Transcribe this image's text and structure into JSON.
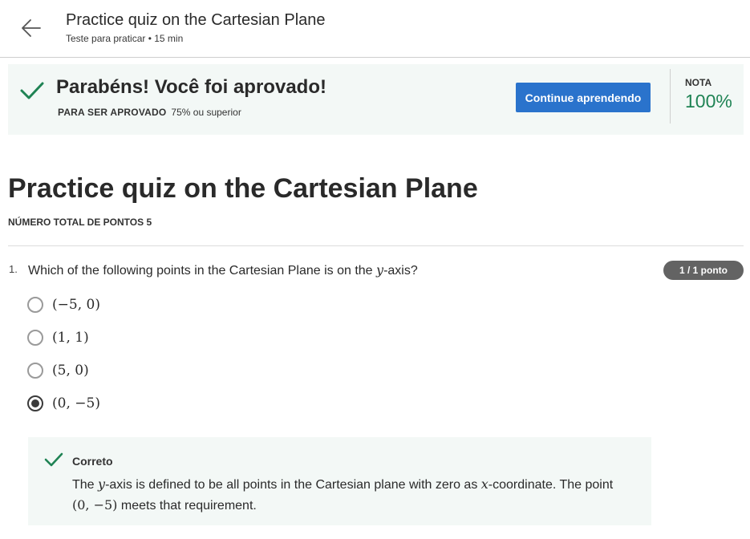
{
  "header": {
    "title": "Practice quiz on the Cartesian Plane",
    "subtitle": "Teste para praticar • 15 min"
  },
  "banner": {
    "title": "Parabéns! Você foi aprovado!",
    "pass_label": "PARA SER APROVADO",
    "pass_value": "75% ou superior",
    "continue_label": "Continue aprendendo",
    "grade_label": "NOTA",
    "grade_value": "100%"
  },
  "main": {
    "title": "Practice quiz on the Cartesian Plane",
    "total_points": "NÚMERO TOTAL DE PONTOS 5"
  },
  "question": {
    "number": "1.",
    "text_before": "Which of the following points in the Cartesian Plane is on the ",
    "variable": "y",
    "text_after": "-axis?",
    "points": "1 / 1 ponto",
    "options": [
      {
        "label": "(−5, 0)",
        "selected": false
      },
      {
        "label": "(1, 1)",
        "selected": false
      },
      {
        "label": "(5, 0)",
        "selected": false
      },
      {
        "label": "(0, −5)",
        "selected": true
      }
    ]
  },
  "feedback": {
    "title": "Correto",
    "t1": "The ",
    "v1": "y",
    "t2": "-axis is defined to be all points in the Cartesian plane with zero as ",
    "v2": "x",
    "t3": "-coordinate. The point ",
    "v3": "(0, −5)",
    "t4": " meets that requirement."
  },
  "colors": {
    "accent": "#2a73cc",
    "success": "#1f8354",
    "banner_bg": "#f3f8f6"
  },
  "icons": {
    "back": "arrow-left-icon",
    "check": "checkmark-icon"
  }
}
